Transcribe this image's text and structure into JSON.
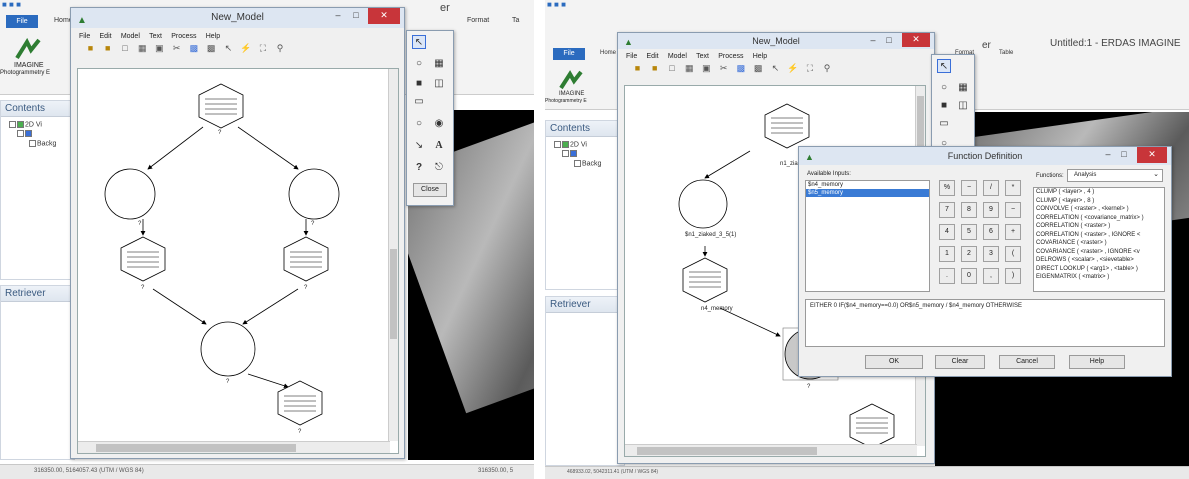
{
  "left": {
    "app": {
      "tabs": [
        "File",
        "Home",
        "Format",
        "Ta"
      ],
      "brand_line1": "IMAGINE",
      "brand_line2": "Photogrammetry E",
      "contents_label": "Contents",
      "tree": [
        "2D Vi",
        "Backg"
      ],
      "retriever_label": "Retriever",
      "ribbon_fragment": "er",
      "status_left": "316350.00, 5164057.43  (UTM / WGS 84)",
      "status_right": "316350.00, 5"
    },
    "model_window": {
      "title": "New_Model",
      "menu": [
        "File",
        "Edit",
        "Model",
        "Text",
        "Process",
        "Help"
      ],
      "node_labels": [
        "?",
        "?",
        "?",
        "?",
        "?",
        "?",
        "?",
        "?"
      ]
    },
    "toolbox": {
      "close_label": "Close",
      "text_tool": "A",
      "help_tool": "?"
    }
  },
  "right": {
    "app": {
      "tabs": [
        "File",
        "Home",
        "Format",
        "Table"
      ],
      "brand_line1": "IMAGINE",
      "brand_line2": "Photogrammetry E",
      "contents_label": "Contents",
      "tree": [
        "2D Vi",
        "Backg"
      ],
      "retriever_label": "Retriever",
      "ribbon_fragment": "er",
      "app_title": "Untitled:1 - ERDAS IMAGINE",
      "status_left": "468933.02, 5042311.41  (UTM / WGS 84)"
    },
    "model_window": {
      "title": "New_Model",
      "menu": [
        "File",
        "Edit",
        "Model",
        "Text",
        "Process",
        "Help"
      ],
      "node_labels": [
        "n1_ziaked_3_5",
        "$n1_ziaked_3_5(1)",
        "n4_memory",
        "?"
      ]
    },
    "function_dialog": {
      "title": "Function Definition",
      "available_inputs_label": "Available Inputs:",
      "inputs": [
        "$n4_memory",
        "$n5_memory"
      ],
      "functions_label": "Functions:",
      "functions_category": "Analysis",
      "functions": [
        "CLUMP ( <layer> , 4 )",
        "CLUMP ( <layer> , 8 )",
        "CONVOLVE ( <raster> , <kernel> )",
        "CORRELATION ( <covariance_matrix> )",
        "CORRELATION ( <raster> )",
        "CORRELATION ( <raster> , IGNORE <",
        "COVARIANCE ( <raster> )",
        "COVARIANCE ( <raster> , IGNORE <v",
        "DELROWS ( <scalar> , <sievetable>",
        "DIRECT LOOKUP ( <arg1> , <table> )",
        "EIGENMATRIX ( <matrix> )"
      ],
      "keypad": [
        "%",
        "−",
        "/",
        "*",
        "7",
        "8",
        "9",
        "−",
        "4",
        "5",
        "6",
        "+",
        "1",
        "2",
        "3",
        "(",
        ".",
        "0",
        ",",
        ")"
      ],
      "expression": "EITHER 0 IF($n4_memory==0.0) OR$n5_memory / $n4_memory OTHERWISE",
      "buttons": [
        "OK",
        "Clear",
        "Cancel",
        "Help"
      ]
    }
  }
}
